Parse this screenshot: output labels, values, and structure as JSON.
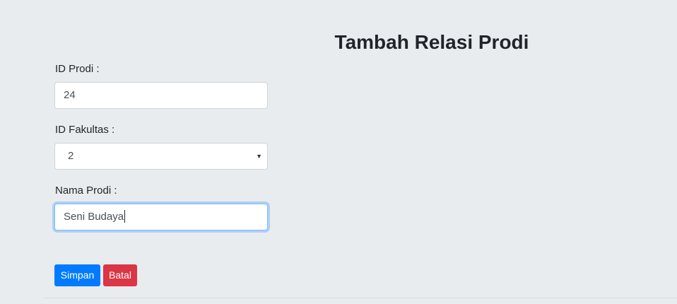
{
  "page": {
    "title": "Tambah Relasi Prodi"
  },
  "form": {
    "id_prodi": {
      "label": "ID Prodi :",
      "value": "24"
    },
    "id_fakultas": {
      "label": "ID Fakultas :",
      "selected": "2",
      "caret_icon": "caret-down-icon"
    },
    "nama_prodi": {
      "label": "Nama Prodi :",
      "value": "Seni Budaya"
    }
  },
  "actions": {
    "save_label": "Simpan",
    "cancel_label": "Batal"
  },
  "colors": {
    "background": "#e9ecef",
    "primary": "#007bff",
    "danger": "#dc3545",
    "focus_border": "#80bdff"
  }
}
